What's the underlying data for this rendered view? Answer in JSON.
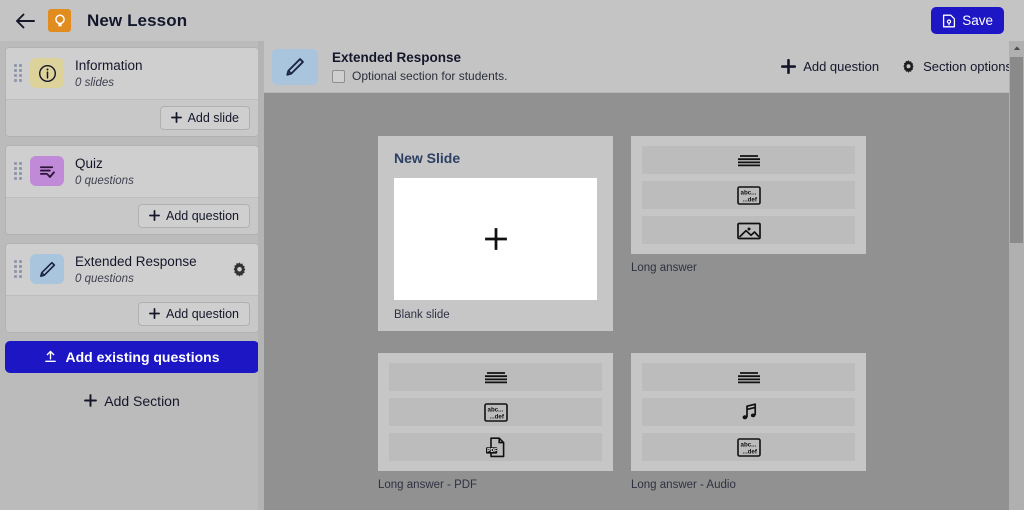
{
  "topbar": {
    "back_icon": "arrow-left-icon",
    "logo_icon": "lightbulb-icon",
    "title": "New Lesson",
    "save_label": "Save",
    "save_icon": "save-document-icon",
    "accent_blue": "#1c16c4",
    "logo_orange": "#e08c1e"
  },
  "sidebar": {
    "sections": [
      {
        "title": "Information",
        "subtitle": "0 slides",
        "icon": "info-circle-icon",
        "icon_color": "#ddd39a",
        "action_label": "Add slide",
        "action_icon": "plus-icon",
        "has_gear": false
      },
      {
        "title": "Quiz",
        "subtitle": "0 questions",
        "icon": "quiz-checklist-icon",
        "icon_color": "#c08ad8",
        "action_label": "Add question",
        "action_icon": "plus-icon",
        "has_gear": false
      },
      {
        "title": "Extended Response",
        "subtitle": "0 questions",
        "icon": "pencil-icon",
        "icon_color": "#a9c5dd",
        "action_label": "Add question",
        "action_icon": "plus-icon",
        "has_gear": true,
        "gear_icon": "gear-icon"
      }
    ],
    "add_existing_label": "Add existing questions",
    "add_existing_icon": "upload-icon",
    "add_section_label": "Add Section",
    "add_section_icon": "plus-icon"
  },
  "main_header": {
    "icon": "pencil-icon",
    "title": "Extended Response",
    "checkbox_label": "Optional section for students.",
    "checkbox_checked": false,
    "add_question_label": "Add question",
    "add_question_icon": "plus-icon",
    "section_options_label": "Section options",
    "section_options_icon": "gear-icon"
  },
  "picker": {
    "new_slide_title": "New Slide",
    "blank_slide_caption": "Blank slide",
    "blank_slide_icon": "plus-icon",
    "options": [
      {
        "caption": "Long answer",
        "rows": [
          "lines-icon",
          "abc-def-icon",
          "image-icon"
        ]
      },
      {
        "caption": "Long answer - PDF",
        "rows": [
          "lines-icon",
          "abc-def-icon",
          "pdf-icon"
        ]
      },
      {
        "caption": "Long answer - Audio",
        "rows": [
          "lines-icon",
          "music-note-icon",
          "abc-def-icon"
        ]
      }
    ]
  },
  "scrollbar": {
    "up_arrow_icon": "chevron-up-icon"
  }
}
